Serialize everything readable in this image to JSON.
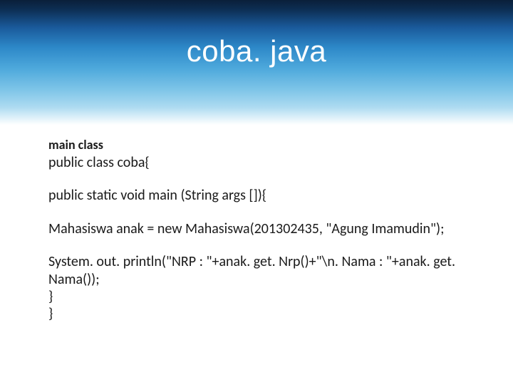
{
  "slide": {
    "title": "coba. java",
    "subtitle": "main class",
    "code": {
      "line1": "public class coba{",
      "line2": "public static void main (String args []){",
      "line3": "Mahasiswa anak = new Mahasiswa(201302435, \"Agung Imamudin\");",
      "line4": "System. out. println(\"NRP  : \"+anak. get. Nrp()+\"\\n. Nama : \"+anak. get. Nama());",
      "line5": "}",
      "line6": "}"
    }
  }
}
